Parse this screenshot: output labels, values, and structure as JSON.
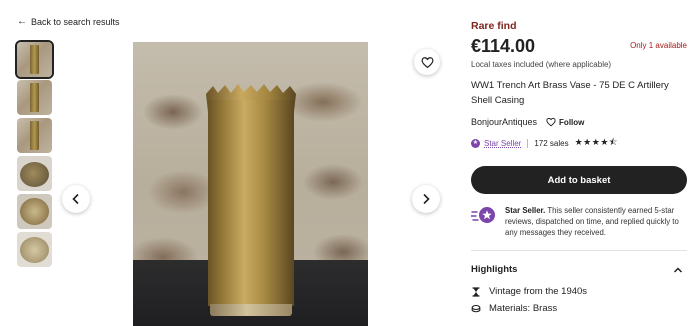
{
  "nav": {
    "back_label": "Back to search results"
  },
  "gallery": {
    "thumbnails": [
      "shell-casing-front",
      "shell-casing-side",
      "shell-casing-angle",
      "shell-casing-top",
      "shell-casing-base",
      "shell-casing-stamp"
    ],
    "active_index": 0
  },
  "listing": {
    "rare_label": "Rare find",
    "price": "€114.00",
    "availability": "Only 1 available",
    "tax_note": "Local taxes included (where applicable)",
    "title": "WW1 Trench Art Brass Vase - 75 DE C Artillery Shell Casing"
  },
  "shop": {
    "name": "BonjourAntiques",
    "follow_label": "Follow",
    "star_seller_label": "Star Seller",
    "sales": "172 sales",
    "rating_stars": "★★★★⯪",
    "rating": 4.5
  },
  "actions": {
    "add_to_basket": "Add to basket"
  },
  "star_seller_info": {
    "heading": "Star Seller.",
    "body": " This seller consistently earned 5-star reviews, dispatched on time, and replied quickly to any messages they received."
  },
  "highlights": {
    "heading": "Highlights",
    "items": [
      {
        "icon": "vintage-icon",
        "label": "Vintage from the 1940s"
      },
      {
        "icon": "materials-icon",
        "label": "Materials: Brass"
      }
    ]
  },
  "colors": {
    "rare": "#7d2520",
    "availability": "#a61a1a",
    "star_seller": "#7b45a9",
    "button": "#222222"
  }
}
